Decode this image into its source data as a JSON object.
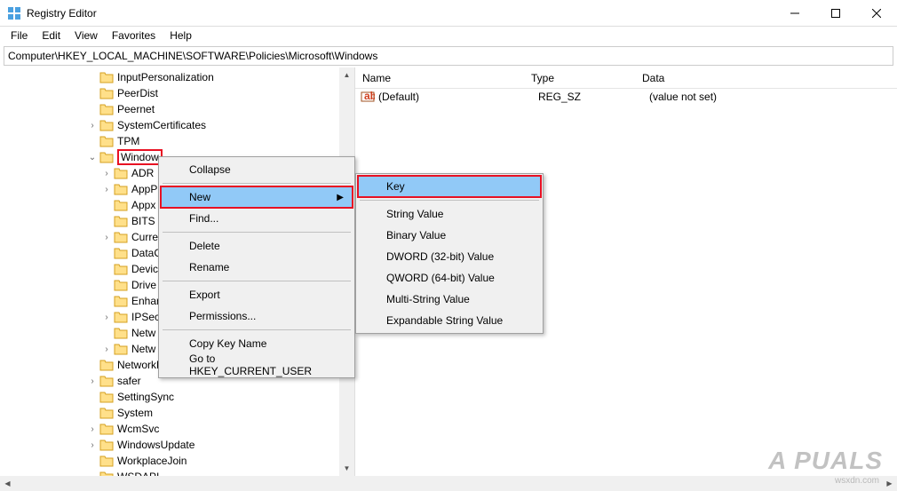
{
  "title": "Registry Editor",
  "menubar": [
    "File",
    "Edit",
    "View",
    "Favorites",
    "Help"
  ],
  "address": "Computer\\HKEY_LOCAL_MACHINE\\SOFTWARE\\Policies\\Microsoft\\Windows",
  "tree": [
    {
      "indent": 96,
      "exp": "",
      "label": "InputPersonalization"
    },
    {
      "indent": 96,
      "exp": "",
      "label": "PeerDist"
    },
    {
      "indent": 96,
      "exp": "",
      "label": "Peernet"
    },
    {
      "indent": 96,
      "exp": ">",
      "label": "SystemCertificates"
    },
    {
      "indent": 96,
      "exp": "",
      "label": "TPM"
    },
    {
      "indent": 96,
      "exp": "v",
      "label": "Window",
      "selected": true
    },
    {
      "indent": 112,
      "exp": ">",
      "label": "ADR"
    },
    {
      "indent": 112,
      "exp": ">",
      "label": "AppP"
    },
    {
      "indent": 112,
      "exp": "",
      "label": "Appx"
    },
    {
      "indent": 112,
      "exp": "",
      "label": "BITS"
    },
    {
      "indent": 112,
      "exp": ">",
      "label": "Curre"
    },
    {
      "indent": 112,
      "exp": "",
      "label": "DataC"
    },
    {
      "indent": 112,
      "exp": "",
      "label": "Devic"
    },
    {
      "indent": 112,
      "exp": "",
      "label": "Drive"
    },
    {
      "indent": 112,
      "exp": "",
      "label": "Enhar"
    },
    {
      "indent": 112,
      "exp": ">",
      "label": "IPSec"
    },
    {
      "indent": 112,
      "exp": "",
      "label": "Netw"
    },
    {
      "indent": 112,
      "exp": ">",
      "label": "Netw"
    },
    {
      "indent": 96,
      "exp": "",
      "label": "NetworkProvider"
    },
    {
      "indent": 96,
      "exp": ">",
      "label": "safer"
    },
    {
      "indent": 96,
      "exp": "",
      "label": "SettingSync"
    },
    {
      "indent": 96,
      "exp": "",
      "label": "System"
    },
    {
      "indent": 96,
      "exp": ">",
      "label": "WcmSvc"
    },
    {
      "indent": 96,
      "exp": ">",
      "label": "WindowsUpdate"
    },
    {
      "indent": 96,
      "exp": "",
      "label": "WorkplaceJoin"
    },
    {
      "indent": 96,
      "exp": "",
      "label": "WSDAPI"
    }
  ],
  "list": {
    "headers": {
      "name": "Name",
      "type": "Type",
      "data": "Data"
    },
    "rows": [
      {
        "name": "(Default)",
        "type": "REG_SZ",
        "data": "(value not set)"
      }
    ]
  },
  "context1": [
    {
      "label": "Collapse",
      "sep_after": true
    },
    {
      "label": "New",
      "submenu": true,
      "highlighted": true,
      "boxed": true
    },
    {
      "label": "Find...",
      "sep_after": true
    },
    {
      "label": "Delete"
    },
    {
      "label": "Rename",
      "sep_after": true
    },
    {
      "label": "Export"
    },
    {
      "label": "Permissions...",
      "sep_after": true
    },
    {
      "label": "Copy Key Name"
    },
    {
      "label": "Go to HKEY_CURRENT_USER"
    }
  ],
  "context2": [
    {
      "label": "Key",
      "highlighted": true,
      "boxed": true,
      "sep_after": true
    },
    {
      "label": "String Value"
    },
    {
      "label": "Binary Value"
    },
    {
      "label": "DWORD (32-bit) Value"
    },
    {
      "label": "QWORD (64-bit) Value"
    },
    {
      "label": "Multi-String Value"
    },
    {
      "label": "Expandable String Value"
    }
  ],
  "watermark": "A  PUALS",
  "watermark_sub": "wsxdn.com"
}
